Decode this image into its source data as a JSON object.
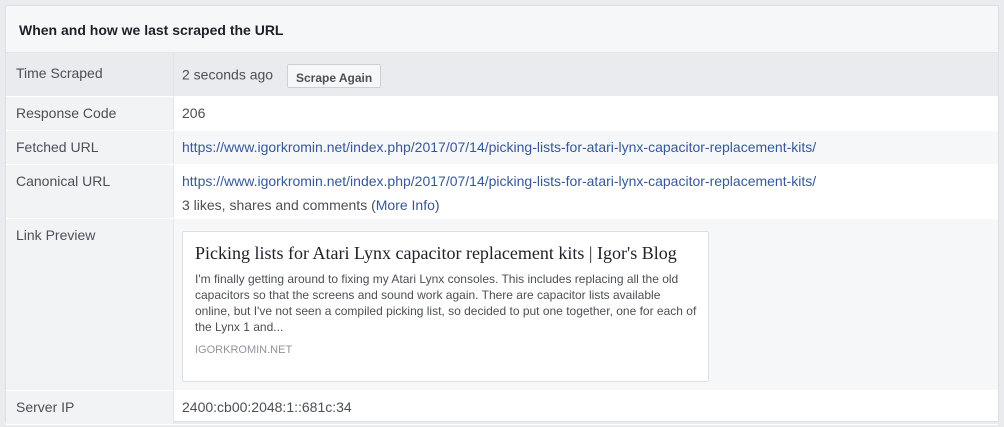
{
  "panel": {
    "title": "When and how we last scraped the URL"
  },
  "rows": {
    "time_scraped": {
      "label": "Time Scraped",
      "value": "2 seconds ago",
      "button_label": "Scrape Again"
    },
    "response_code": {
      "label": "Response Code",
      "value": "206"
    },
    "fetched_url": {
      "label": "Fetched URL",
      "value": "https://www.igorkromin.net/index.php/2017/07/14/picking-lists-for-atari-lynx-capacitor-replacement-kits/"
    },
    "canonical_url": {
      "label": "Canonical URL",
      "value": "https://www.igorkromin.net/index.php/2017/07/14/picking-lists-for-atari-lynx-capacitor-replacement-kits/",
      "stats_text": "3 likes, shares and comments (",
      "more_info": "More Info",
      "stats_close": ")"
    },
    "link_preview": {
      "label": "Link Preview",
      "title": "Picking lists for Atari Lynx capacitor replacement kits | Igor's Blog",
      "description": "I'm finally getting around to fixing my Atari Lynx consoles. This includes replacing all the old capacitors so that the screens and sound work again. There are capacitor lists available online, but I've not seen a compiled picking list, so decided to put one together, one for each of the Lynx 1 and...",
      "domain": "IGORKROMIN.NET"
    },
    "server_ip": {
      "label": "Server IP",
      "value": "2400:cb00:2048:1::681c:34"
    }
  },
  "colors": {
    "link": "#365899",
    "text": "#4b4f56",
    "header_bg": "#f6f7f9",
    "border": "#dddfe2"
  }
}
